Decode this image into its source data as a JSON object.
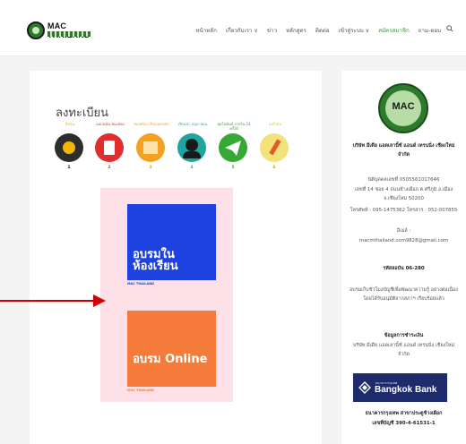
{
  "header": {
    "logo_text": "MAC THAILAND",
    "nav": [
      {
        "label": "หน้าหลัก"
      },
      {
        "label": "เกี่ยวกับเรา ∨"
      },
      {
        "label": "ข่าว"
      },
      {
        "label": "หลักสูตร"
      },
      {
        "label": "ติดต่อ"
      },
      {
        "label": "เข้าสู่ระบบ ∨"
      },
      {
        "label": "สมัครสมาชิก"
      },
      {
        "label": "ถาม-ตอบ"
      }
    ]
  },
  "main": {
    "title": "ลงทะเบียน",
    "steps": [
      {
        "label": "สิ่งเงิน",
        "number": "1",
        "color": "#f2b705",
        "circle": "#2d2d2d"
      },
      {
        "label": "แสกนมัน ชนะทอง",
        "number": "2",
        "color": "#e02e2e",
        "circle": "#e02e2e"
      },
      {
        "label": "ชอบดับน เรียกแอ่งหลัก",
        "number": "3",
        "color": "#f4a020",
        "circle": "#f4a020"
      },
      {
        "label": "เรียนนำ อนุบาลมน",
        "number": "4",
        "color": "#2ba8c6",
        "circle": "#1fa5a0"
      },
      {
        "label": "ชุดในมินส์ ภายใน 14 ครั้งปิ",
        "number": "5",
        "color": "#3aa83a",
        "circle": "#36a836"
      },
      {
        "label": "ลงสิ่งมัน",
        "number": "6",
        "color": "#e6c800",
        "circle": "#f2e27a"
      }
    ],
    "promo1": {
      "text": "อบรมใน ห้องเรียน",
      "caption": "MAC THAILAND"
    },
    "promo2": {
      "text": "อบรม Online",
      "caption": "MAC THAILAND"
    }
  },
  "sidebar": {
    "logo_text": "MAC",
    "company": "บริษัท มีเดีย แอดเลานิ้ซ์ แอนด์ เทรนนิ่ง เชียงใหม่ จำกัด",
    "tax_id": "นิติบุคคลเลขที่ 0505561017646",
    "address": "เลขที่ 14 ซอย 4 ถนนช้างเผือก ต.ศรีภูมิ อ.เมือง จ.เชียงใหม่ 50200",
    "phone": "โทรศัพท์ : 095-1475362 โทรสาร : 052-007855",
    "email_label": "อีเมล์ :",
    "email": "macmthailand.com9828@gmail.com",
    "training_code": "รหัสลอบัน 06-280",
    "training_desc": "อบรมเก็บชั่วโมงบัญชีเพื่อพัฒนาความรู้ อย่างต่อเนื่องโดยได้รับอนุมัติจากสภาฯ เรียบร้อยแล้ว",
    "payment_title": "ข้อมูลการชำระเงิน",
    "payment_company": "บริษัท มีเดีย แอดเลานิ้ซ์ แอนด์ เทรนนิ่ง เชียงใหม่ จำกัด",
    "bank_small": "ธนาคารกรุงเทพ",
    "bank_name": "Bangkok Bank",
    "bank_branch": "ธนาคารกรุงเทพ สาขาประตูช้างเผือก",
    "account": "เลขที่บัญชี 390-4-61531-1"
  },
  "colors": {
    "accent_green": "#3a9a3a",
    "arrow_red": "#d40000"
  }
}
